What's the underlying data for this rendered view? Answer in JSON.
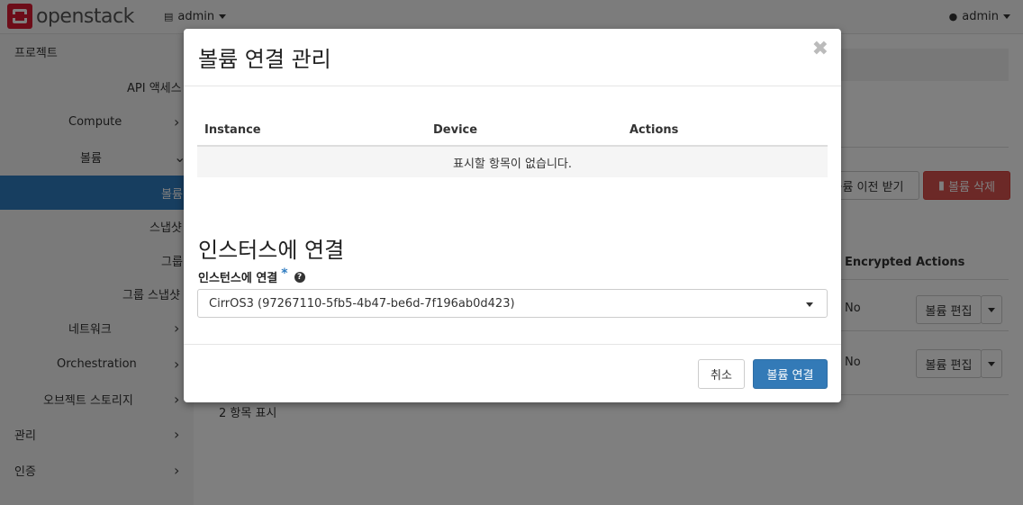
{
  "navbar": {
    "brand": "openstack",
    "project_menu": "admin",
    "user_menu": "admin"
  },
  "sidebar": {
    "items": [
      {
        "label": "프로젝트"
      },
      {
        "label": "API 액세스"
      },
      {
        "label": "Compute"
      },
      {
        "label": "볼륨"
      },
      {
        "label": "볼륨"
      },
      {
        "label": "스냅샷"
      },
      {
        "label": "그룹"
      },
      {
        "label": "그룹 스냅샷"
      },
      {
        "label": "네트워크"
      },
      {
        "label": "Orchestration"
      },
      {
        "label": "오브젝트 스토리지"
      },
      {
        "label": "관리"
      },
      {
        "label": "인증"
      }
    ]
  },
  "background": {
    "transfer_button": "볼륨 이전 받기",
    "delete_button": "볼륨 삭제",
    "columns": [
      "Encrypted",
      "Actions"
    ],
    "rows": [
      {
        "encrypted": "No",
        "action": "볼륨 편집"
      },
      {
        "encrypted": "No",
        "action": "볼륨 편집"
      }
    ],
    "count_text": "2 항목 표시"
  },
  "modal": {
    "title": "볼륨 연결 관리",
    "table": {
      "headers": [
        "Instance",
        "Device",
        "Actions"
      ],
      "empty_text": "표시할 항목이 없습니다."
    },
    "section_title": "인스터스에 연결",
    "field_label": "인스턴스에 연결",
    "required_mark": "*",
    "select_value": "CirrOS3 (97267110-5fb5-4b47-be6d-7f196ab0d423)",
    "cancel_label": "취소",
    "submit_label": "볼륨 연결"
  }
}
